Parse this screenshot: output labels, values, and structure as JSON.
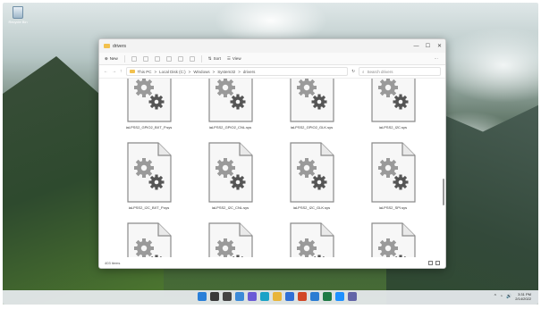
{
  "desktop": {
    "recycle_bin_label": "Recycle Bin"
  },
  "window": {
    "title": "drivers",
    "controls": {
      "minimize": "—",
      "maximize": "☐",
      "close": "✕"
    }
  },
  "toolbar": {
    "new_label": "New",
    "sort_label": "Sort",
    "view_label": "View",
    "more_label": "···"
  },
  "address": {
    "path": [
      "This PC",
      "Local Disk (C:)",
      "Windows",
      "System32",
      "drivers"
    ],
    "separator": ">",
    "search_placeholder": "Search drivers"
  },
  "files": [
    "iaLPSS2_GPIO2_BXT_P.sys",
    "iaLPSS2_GPIO2_CNL.sys",
    "iaLPSS2_GPIO2_GLK.sys",
    "iaLPSS2_I2C.sys",
    "iaLPSS2_I2C_BXT_P.sys",
    "iaLPSS2_I2C_CNL.sys",
    "iaLPSS2_I2C_GLK.sys",
    "iaLPSS2_SPI.sys",
    "iaLPSS2_UART2.sys",
    "iaStorAVC.sys",
    "ibbus.sys",
    "IdeLsz.sys"
  ],
  "status": {
    "item_count": "403 items"
  },
  "taskbar": {
    "app_icons": [
      {
        "name": "start-icon",
        "color": "#2a7fd8"
      },
      {
        "name": "search-icon",
        "color": "#3a3a3a"
      },
      {
        "name": "task-view-icon",
        "color": "#444444"
      },
      {
        "name": "widgets-icon",
        "color": "#3b8ad8"
      },
      {
        "name": "chat-icon",
        "color": "#6b5bd6"
      },
      {
        "name": "edge-icon",
        "color": "#1aa2c7"
      },
      {
        "name": "explorer-icon",
        "color": "#e8b53a"
      },
      {
        "name": "store-icon",
        "color": "#2f6fd6"
      },
      {
        "name": "office-icon",
        "color": "#d24726"
      },
      {
        "name": "mail-icon",
        "color": "#2b7cd3"
      },
      {
        "name": "excel-icon",
        "color": "#1f7a45"
      },
      {
        "name": "photos-icon",
        "color": "#1e90ff"
      },
      {
        "name": "teams-icon",
        "color": "#6264a7"
      }
    ],
    "tray_symbols": [
      "^",
      "◔",
      "🔊"
    ],
    "time": "3:31 PM",
    "date": "2/14/2022"
  }
}
